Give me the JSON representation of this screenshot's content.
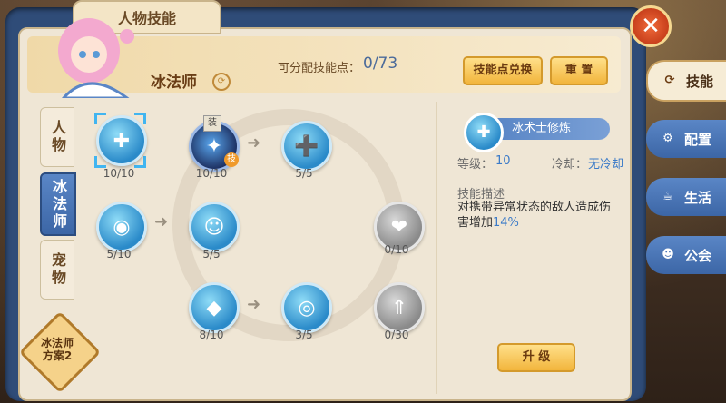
{
  "window": {
    "title": "人物技能",
    "close": "✕"
  },
  "header": {
    "class_name": "冰法师",
    "class_icon": "⟳",
    "points_label": "可分配技能点：",
    "points_value": "0/73",
    "exchange_button": "技能点兑换",
    "reset_button": "重 置"
  },
  "left_tabs": [
    {
      "label": "人物",
      "active": false
    },
    {
      "label": "冰法师",
      "active": true
    },
    {
      "label": "宠物",
      "active": false
    }
  ],
  "plan_badge": {
    "line1": "冰法师",
    "line2": "方案2"
  },
  "skills": [
    {
      "icon": "shield-plus-icon",
      "glyph": "✚",
      "count": "10/10",
      "style": "blue",
      "selected": true
    },
    {
      "icon": "ice-crystal-icon",
      "glyph": "✦",
      "count": "10/10",
      "style": "dark",
      "equip": "装",
      "tag": "技"
    },
    {
      "icon": "swirl-plus-icon",
      "glyph": "➕",
      "count": "5/5",
      "style": "blue"
    },
    {
      "icon": "orb-icon",
      "glyph": "◉",
      "count": "5/10",
      "style": "blue"
    },
    {
      "icon": "team-icon",
      "glyph": "☺",
      "count": "5/5",
      "style": "blue"
    },
    {
      "icon": "heart-plus-icon",
      "glyph": "❤",
      "count": "0/10",
      "style": "gray"
    },
    {
      "icon": "diamond-icon",
      "glyph": "◆",
      "count": "8/10",
      "style": "blue"
    },
    {
      "icon": "vortex-icon",
      "glyph": "◎",
      "count": "3/5",
      "style": "blue"
    },
    {
      "icon": "arrows-up-icon",
      "glyph": "⇑",
      "count": "0/30",
      "style": "gray"
    }
  ],
  "detail": {
    "icon": "✚",
    "name": "冰术士修炼",
    "level_label": "等级：",
    "level_value": "10",
    "cooldown_label": "冷却：",
    "cooldown_value": "无冷却",
    "desc_title": "技能描述",
    "desc_text": "对携带异常状态的敌人造成伤害增加",
    "desc_value": "14%",
    "upgrade_button": "升 级"
  },
  "right_tabs": [
    {
      "label": "技能",
      "icon": "skill-icon",
      "glyph": "⟳",
      "active": true
    },
    {
      "label": "配置",
      "icon": "gear-icon",
      "glyph": "⚙",
      "active": false
    },
    {
      "label": "生活",
      "icon": "cup-icon",
      "glyph": "☕",
      "active": false
    },
    {
      "label": "公会",
      "icon": "guild-icon",
      "glyph": "☻",
      "active": false
    }
  ],
  "colors": {
    "accent_blue": "#3c66a6",
    "gold": "#f2b53c",
    "value_blue": "#3a7ac8"
  }
}
